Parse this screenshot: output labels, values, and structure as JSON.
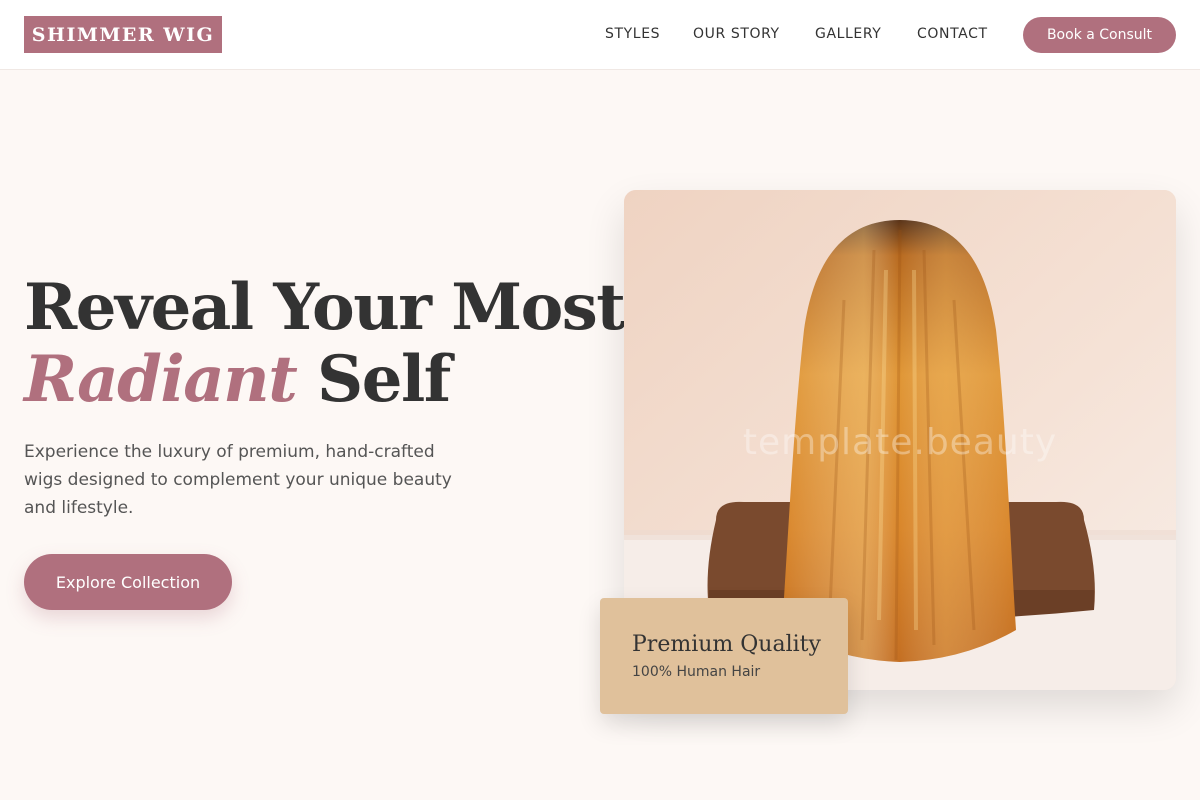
{
  "brand": {
    "name": "SHIMMER WIG",
    "accent": "#b0707e",
    "card_color": "#e0c19b"
  },
  "nav": {
    "items": [
      {
        "label": "STYLES"
      },
      {
        "label": "OUR STORY"
      },
      {
        "label": "GALLERY"
      },
      {
        "label": "CONTACT"
      }
    ],
    "cta": "Book a Consult"
  },
  "hero": {
    "headline_line1": "Reveal Your Most",
    "headline_accent": "Radiant",
    "headline_end": "Self",
    "subtext": "Experience the luxury of premium, hand-crafted wigs designed to complement your unique beauty and lifestyle.",
    "button": "Explore Collection",
    "image_alt": "Long straight honey-blonde wig on a mannequin head",
    "watermark": "template.beauty"
  },
  "badge": {
    "title": "Premium Quality",
    "subtitle": "100% Human Hair"
  }
}
